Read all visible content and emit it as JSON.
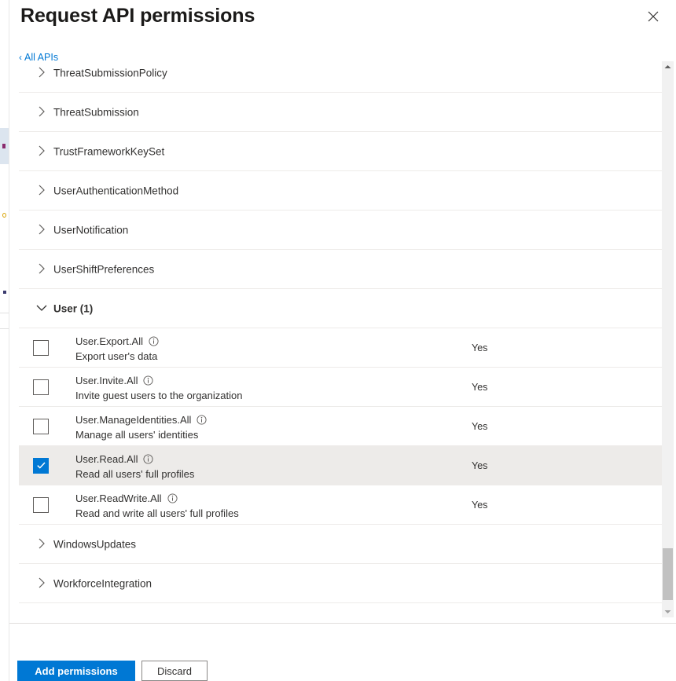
{
  "blade": {
    "title": "Request API permissions",
    "close_label": "close-icon"
  },
  "breadcrumb": {
    "back_label": "All APIs",
    "chevron": "‹"
  },
  "api_groups_top": [
    {
      "name": "ThreatSubmissionPolicy",
      "expanded": false
    },
    {
      "name": "ThreatSubmission",
      "expanded": false
    },
    {
      "name": "TrustFrameworkKeySet",
      "expanded": false
    },
    {
      "name": "UserAuthenticationMethod",
      "expanded": false
    },
    {
      "name": "UserNotification",
      "expanded": false
    },
    {
      "name": "UserShiftPreferences",
      "expanded": false
    }
  ],
  "expanded_group": {
    "name": "User (1)",
    "expanded": true
  },
  "permissions": [
    {
      "name": "User.Export.All",
      "description": "Export user's data",
      "admin_consent": "Yes",
      "checked": false
    },
    {
      "name": "User.Invite.All",
      "description": "Invite guest users to the organization",
      "admin_consent": "Yes",
      "checked": false
    },
    {
      "name": "User.ManageIdentities.All",
      "description": "Manage all users' identities",
      "admin_consent": "Yes",
      "checked": false
    },
    {
      "name": "User.Read.All",
      "description": "Read all users' full profiles",
      "admin_consent": "Yes",
      "checked": true
    },
    {
      "name": "User.ReadWrite.All",
      "description": "Read and write all users' full profiles",
      "admin_consent": "Yes",
      "checked": false
    }
  ],
  "api_groups_bottom": [
    {
      "name": "WindowsUpdates",
      "expanded": false
    },
    {
      "name": "WorkforceIntegration",
      "expanded": false
    }
  ],
  "footer": {
    "primary_label": "Add permissions",
    "secondary_label": "Discard"
  },
  "colors": {
    "accent": "#0078d4",
    "link": "#0078d4",
    "selected_row": "#edebe9",
    "text": "#323130",
    "divider": "#edebe9",
    "scrollbar_thumb": "#c1c1c1"
  }
}
